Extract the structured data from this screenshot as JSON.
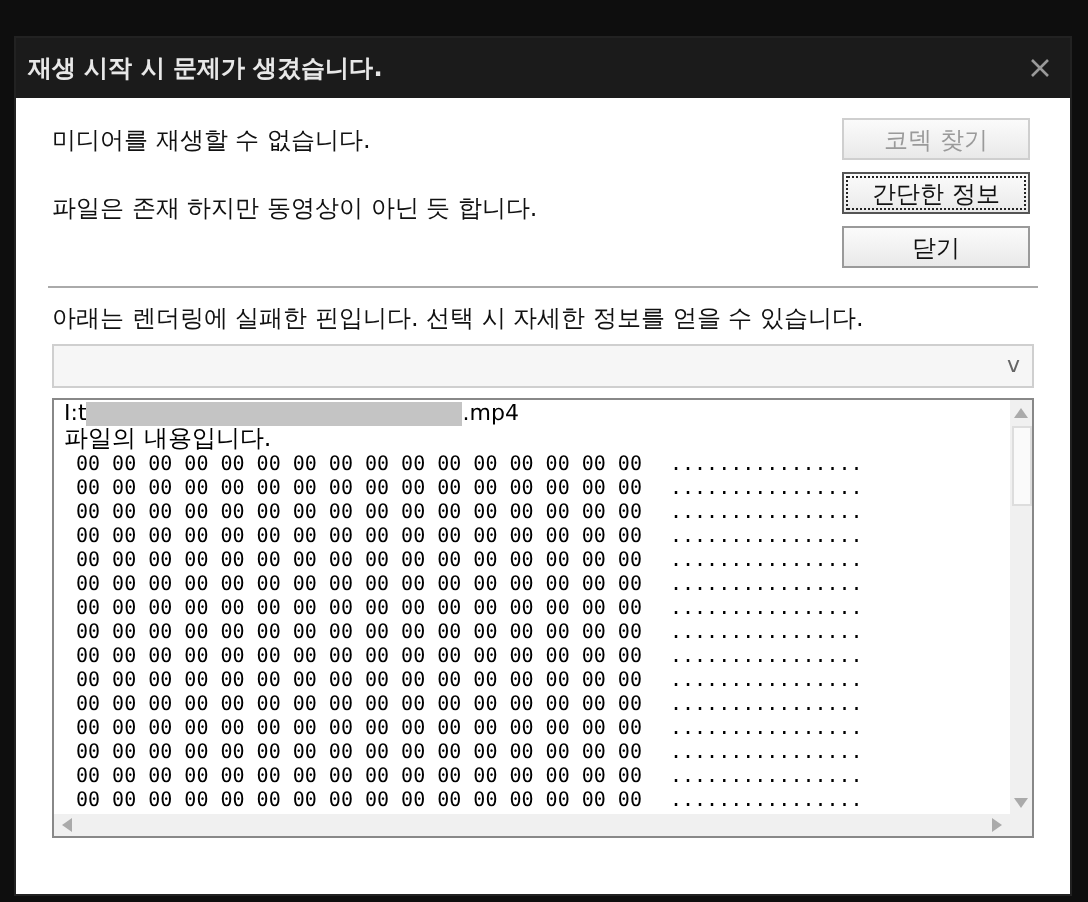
{
  "window": {
    "title": "재생 시작 시 문제가 생겼습니다."
  },
  "messages": [
    "미디어를 재생할 수 없습니다.",
    "파일은 존재 하지만 동영상이 아닌 듯 합니다."
  ],
  "buttons": [
    {
      "label": "코덱 찾기",
      "disabled": true,
      "focused": false
    },
    {
      "label": "간단한 정보",
      "disabled": false,
      "focused": true
    },
    {
      "label": "닫기",
      "disabled": false,
      "focused": false
    }
  ],
  "pin_label": "아래는 렌더링에 실패한 핀입니다. 선택 시 자세한 정보를 얻을 수 있습니다.",
  "pin_select": {
    "arrow": "v"
  },
  "details": {
    "path_start": "I:t",
    "path_end": ".mp4",
    "heading": "파일의 내용입니다.",
    "rows": [
      {
        "hex": "00 00 00 00 00 00 00 00 00 00 00 00 00 00 00 00",
        "ascii": "................"
      },
      {
        "hex": "00 00 00 00 00 00 00 00 00 00 00 00 00 00 00 00",
        "ascii": "................"
      },
      {
        "hex": "00 00 00 00 00 00 00 00 00 00 00 00 00 00 00 00",
        "ascii": "................"
      },
      {
        "hex": "00 00 00 00 00 00 00 00 00 00 00 00 00 00 00 00",
        "ascii": "................"
      },
      {
        "hex": "00 00 00 00 00 00 00 00 00 00 00 00 00 00 00 00",
        "ascii": "................"
      },
      {
        "hex": "00 00 00 00 00 00 00 00 00 00 00 00 00 00 00 00",
        "ascii": "................"
      },
      {
        "hex": "00 00 00 00 00 00 00 00 00 00 00 00 00 00 00 00",
        "ascii": "................"
      },
      {
        "hex": "00 00 00 00 00 00 00 00 00 00 00 00 00 00 00 00",
        "ascii": "................"
      },
      {
        "hex": "00 00 00 00 00 00 00 00 00 00 00 00 00 00 00 00",
        "ascii": "................"
      },
      {
        "hex": "00 00 00 00 00 00 00 00 00 00 00 00 00 00 00 00",
        "ascii": "................"
      },
      {
        "hex": "00 00 00 00 00 00 00 00 00 00 00 00 00 00 00 00",
        "ascii": "................"
      },
      {
        "hex": "00 00 00 00 00 00 00 00 00 00 00 00 00 00 00 00",
        "ascii": "................"
      },
      {
        "hex": "00 00 00 00 00 00 00 00 00 00 00 00 00 00 00 00",
        "ascii": "................"
      },
      {
        "hex": "00 00 00 00 00 00 00 00 00 00 00 00 00 00 00 00",
        "ascii": "................"
      },
      {
        "hex": "00 00 00 00 00 00 00 00 00 00 00 00 00 00 00 00",
        "ascii": "................"
      }
    ]
  }
}
